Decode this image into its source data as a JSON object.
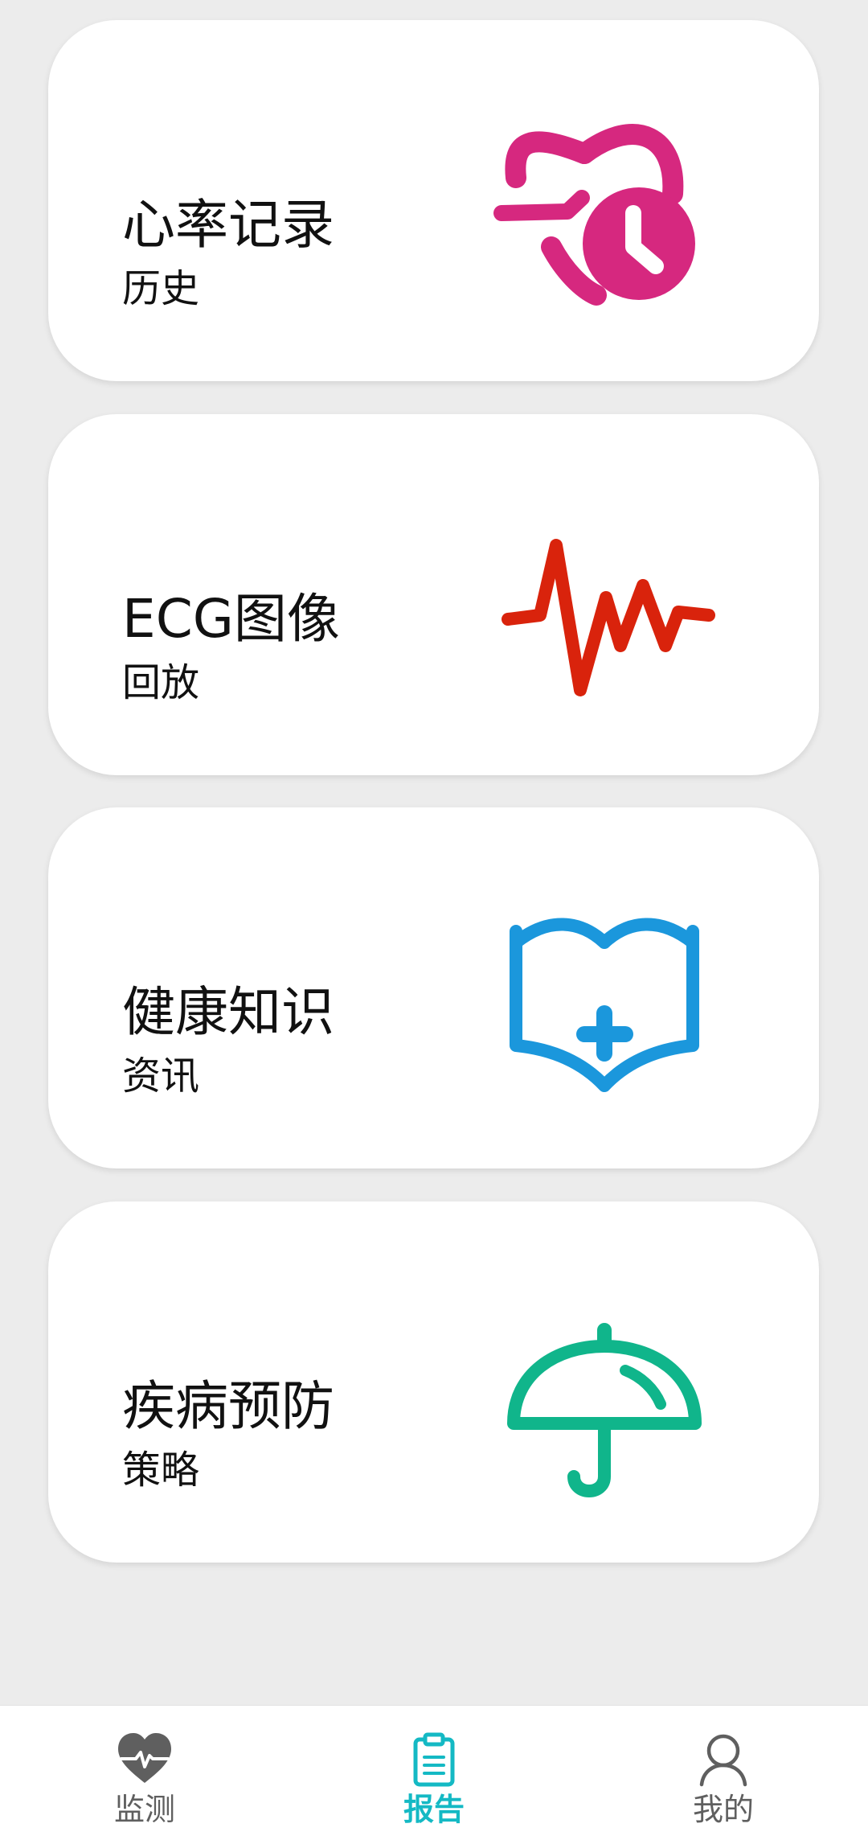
{
  "cards": [
    {
      "title": "心率记录",
      "subtitle": "历史",
      "icon": "heart-clock-icon",
      "color": "#d6287f"
    },
    {
      "title": "ECG图像",
      "subtitle": "回放",
      "icon": "ecg-waveform-icon",
      "color": "#d9230c"
    },
    {
      "title": "健康知识",
      "subtitle": "资讯",
      "icon": "medical-book-icon",
      "color": "#1b97dc"
    },
    {
      "title": "疾病预防",
      "subtitle": "策略",
      "icon": "umbrella-icon",
      "color": "#10b58b"
    }
  ],
  "tabbar": {
    "items": [
      {
        "label": "监测",
        "icon": "heart-pulse-icon",
        "active": false
      },
      {
        "label": "报告",
        "icon": "clipboard-icon",
        "active": true
      },
      {
        "label": "我的",
        "icon": "person-icon",
        "active": false
      }
    ],
    "active_color": "#14b9c4",
    "inactive_color": "#5f5f5f"
  }
}
